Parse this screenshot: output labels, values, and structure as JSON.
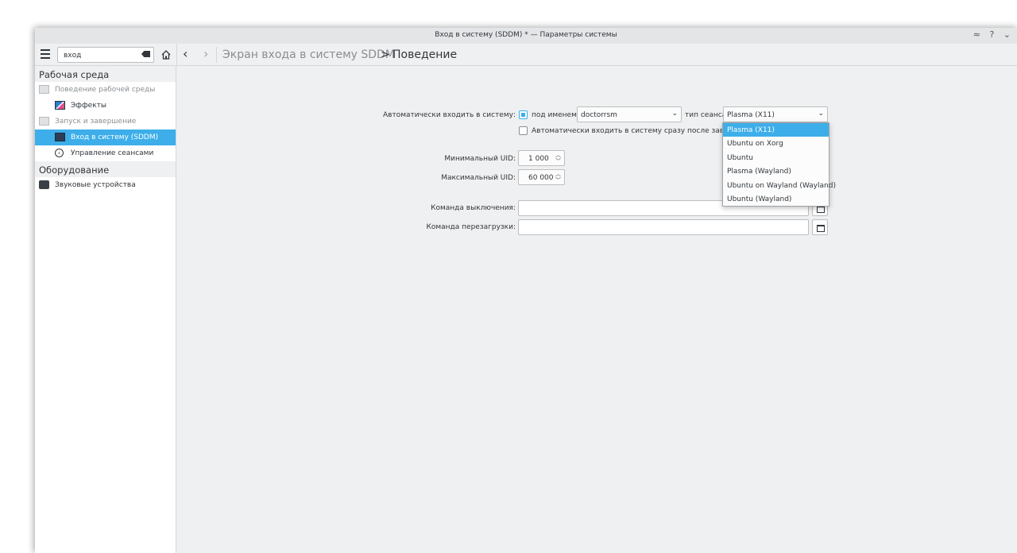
{
  "window": {
    "title": "Вход в систему (SDDM) * — Параметры системы",
    "controls": "≈ ? ⌄"
  },
  "toolbar": {
    "search_value": "вход"
  },
  "breadcrumb": {
    "parent": "Экран входа в систему SDDM",
    "separator": ">",
    "current": "Поведение"
  },
  "sidebar": {
    "categories": [
      "Рабочая среда",
      "Оборудование"
    ],
    "items": [
      {
        "label": "Поведение рабочей среды",
        "icon": "monitor-icon"
      },
      {
        "label": "Эффекты",
        "icon": "effects-icon"
      },
      {
        "label": "Запуск и завершение",
        "icon": "monitor-icon"
      },
      {
        "label": "Вход в систему (SDDM)",
        "icon": "login-screen-icon",
        "selected": true
      },
      {
        "label": "Управление сеансами",
        "icon": "session-icon"
      },
      {
        "label": "Звуковые устройства",
        "icon": "audio-device-icon"
      }
    ]
  },
  "form": {
    "autologin_label": "Автоматически входить в систему:",
    "autologin_checked": true,
    "user_label": "под именем:",
    "user_value": "doctorrsm",
    "session_label": "тип сеанса",
    "session_value": "Plasma (X11)",
    "relogin_label": "Автоматически входить в систему сразу после завершени",
    "relogin_checked": false,
    "min_uid_label": "Минимальный UID:",
    "min_uid_value": "1 000",
    "max_uid_label": "Максимальный UID:",
    "max_uid_value": "60 000",
    "halt_label": "Команда выключения:",
    "reboot_label": "Команда перезагрузки:"
  },
  "session_dropdown": {
    "options": [
      "Plasma (X11)",
      "Ubuntu on Xorg",
      "Ubuntu",
      "Plasma (Wayland)",
      "Ubuntu on Wayland (Wayland)",
      "Ubuntu (Wayland)"
    ],
    "selected_index": 0
  },
  "colors": {
    "accent": "#3daee9",
    "background": "#eff0f1",
    "text": "#31363b"
  }
}
